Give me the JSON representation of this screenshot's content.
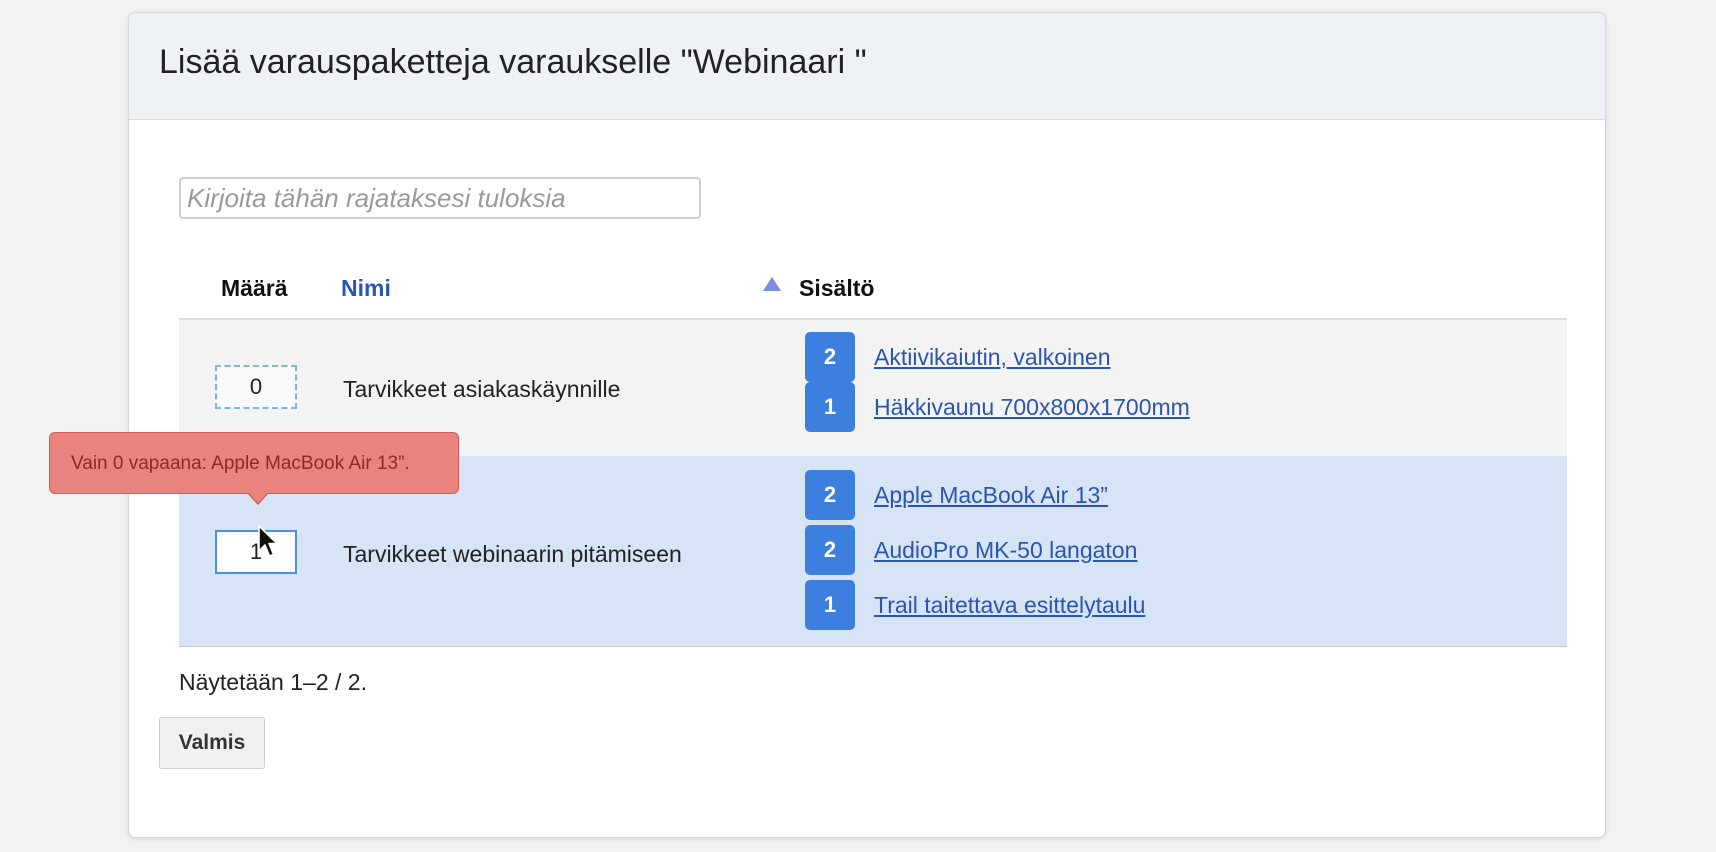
{
  "dialog": {
    "title": "Lisää varauspaketteja varaukselle \"Webinaari \""
  },
  "filter": {
    "placeholder": "Kirjoita tähän rajataksesi tuloksia",
    "value": ""
  },
  "table": {
    "headers": {
      "quantity": "Määrä",
      "name": "Nimi",
      "contents": "Sisältö"
    },
    "sort_icon": "sort-ascending-icon",
    "rows": [
      {
        "quantity": "0",
        "name": "Tarvikkeet asiakaskäynnille",
        "items": [
          {
            "count": "2",
            "label": "Aktiivikaiutin, valkoinen"
          },
          {
            "count": "1",
            "label": "Häkkivaunu 700x800x1700mm"
          }
        ]
      },
      {
        "quantity": "1",
        "name": "Tarvikkeet webinaarin pitämiseen",
        "items": [
          {
            "count": "2",
            "label": "Apple MacBook Air 13”"
          },
          {
            "count": "2",
            "label": "AudioPro MK-50 langaton"
          },
          {
            "count": "1",
            "label": "Trail taitettava esittelytaulu"
          }
        ]
      }
    ]
  },
  "tooltip": {
    "text": "Vain 0 vapaana: Apple MacBook Air 13”."
  },
  "pager": {
    "text": "Näytetään 1–2 / 2."
  },
  "actions": {
    "done_label": "Valmis"
  },
  "colors": {
    "badge": "#3d7fde",
    "link": "#2a56b0",
    "selected_row": "#d6e4f5",
    "tooltip_bg": "#e8837d"
  },
  "cursor": "mouse-pointer-icon"
}
